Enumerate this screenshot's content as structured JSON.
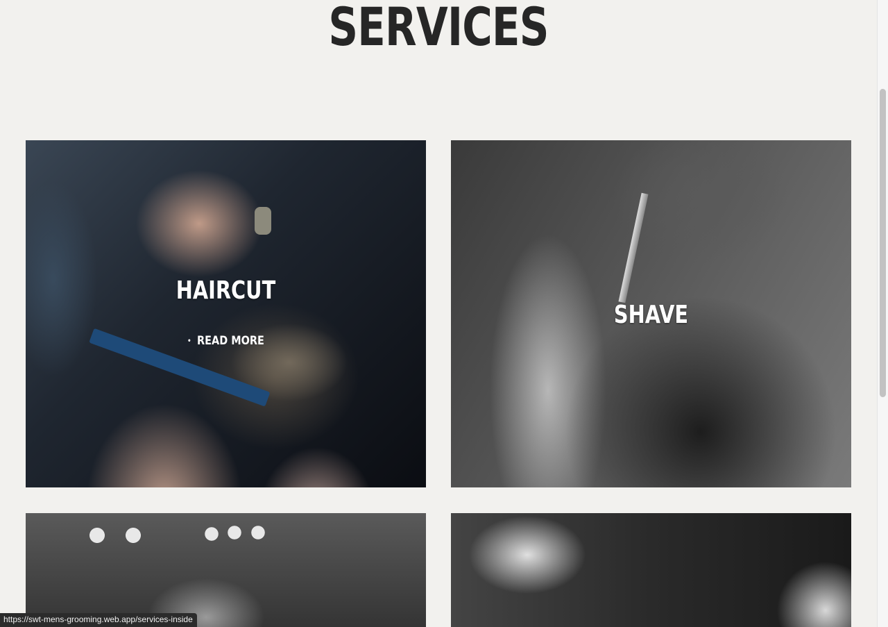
{
  "page": {
    "heading": "SERVICES"
  },
  "services": {
    "cards": [
      {
        "title": "HAIRCUT",
        "read_more": "READ MORE",
        "bullet": "•"
      },
      {
        "title": "SHAVE"
      },
      {
        "title": ""
      },
      {
        "title": ""
      }
    ]
  },
  "status_bar": {
    "url": "https://swt-mens-grooming.web.app/services-inside"
  },
  "colors": {
    "background": "#f2f1ee",
    "heading": "#262626",
    "card_text": "#ffffff"
  }
}
